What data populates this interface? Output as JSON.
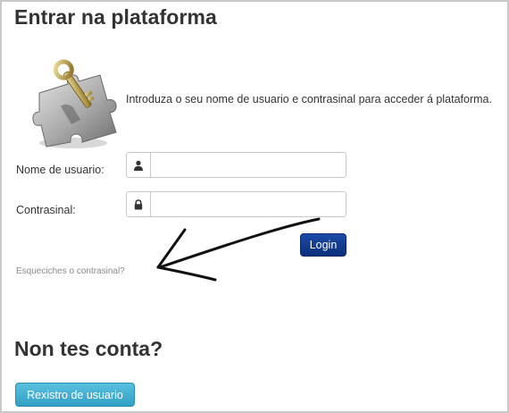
{
  "title": "Entrar na plataforma",
  "intro_text": "Introduza o seu nome de usuario e contrasinal para acceder á plataforma.",
  "form": {
    "username_label": "Nome de usuario:",
    "password_label": "Contrasinal:",
    "username_value": "",
    "password_value": "",
    "username_icon": "user-icon",
    "password_icon": "lock-icon",
    "login_button": "Login",
    "forgot_link": "Esqueciches o contrasinal?"
  },
  "register": {
    "heading": "Non tes conta?",
    "button": "Rexistro de usuario"
  },
  "colors": {
    "login_button": "#0b2f7a",
    "register_button": "#3fb0d6",
    "link": "#8a8a8a"
  }
}
